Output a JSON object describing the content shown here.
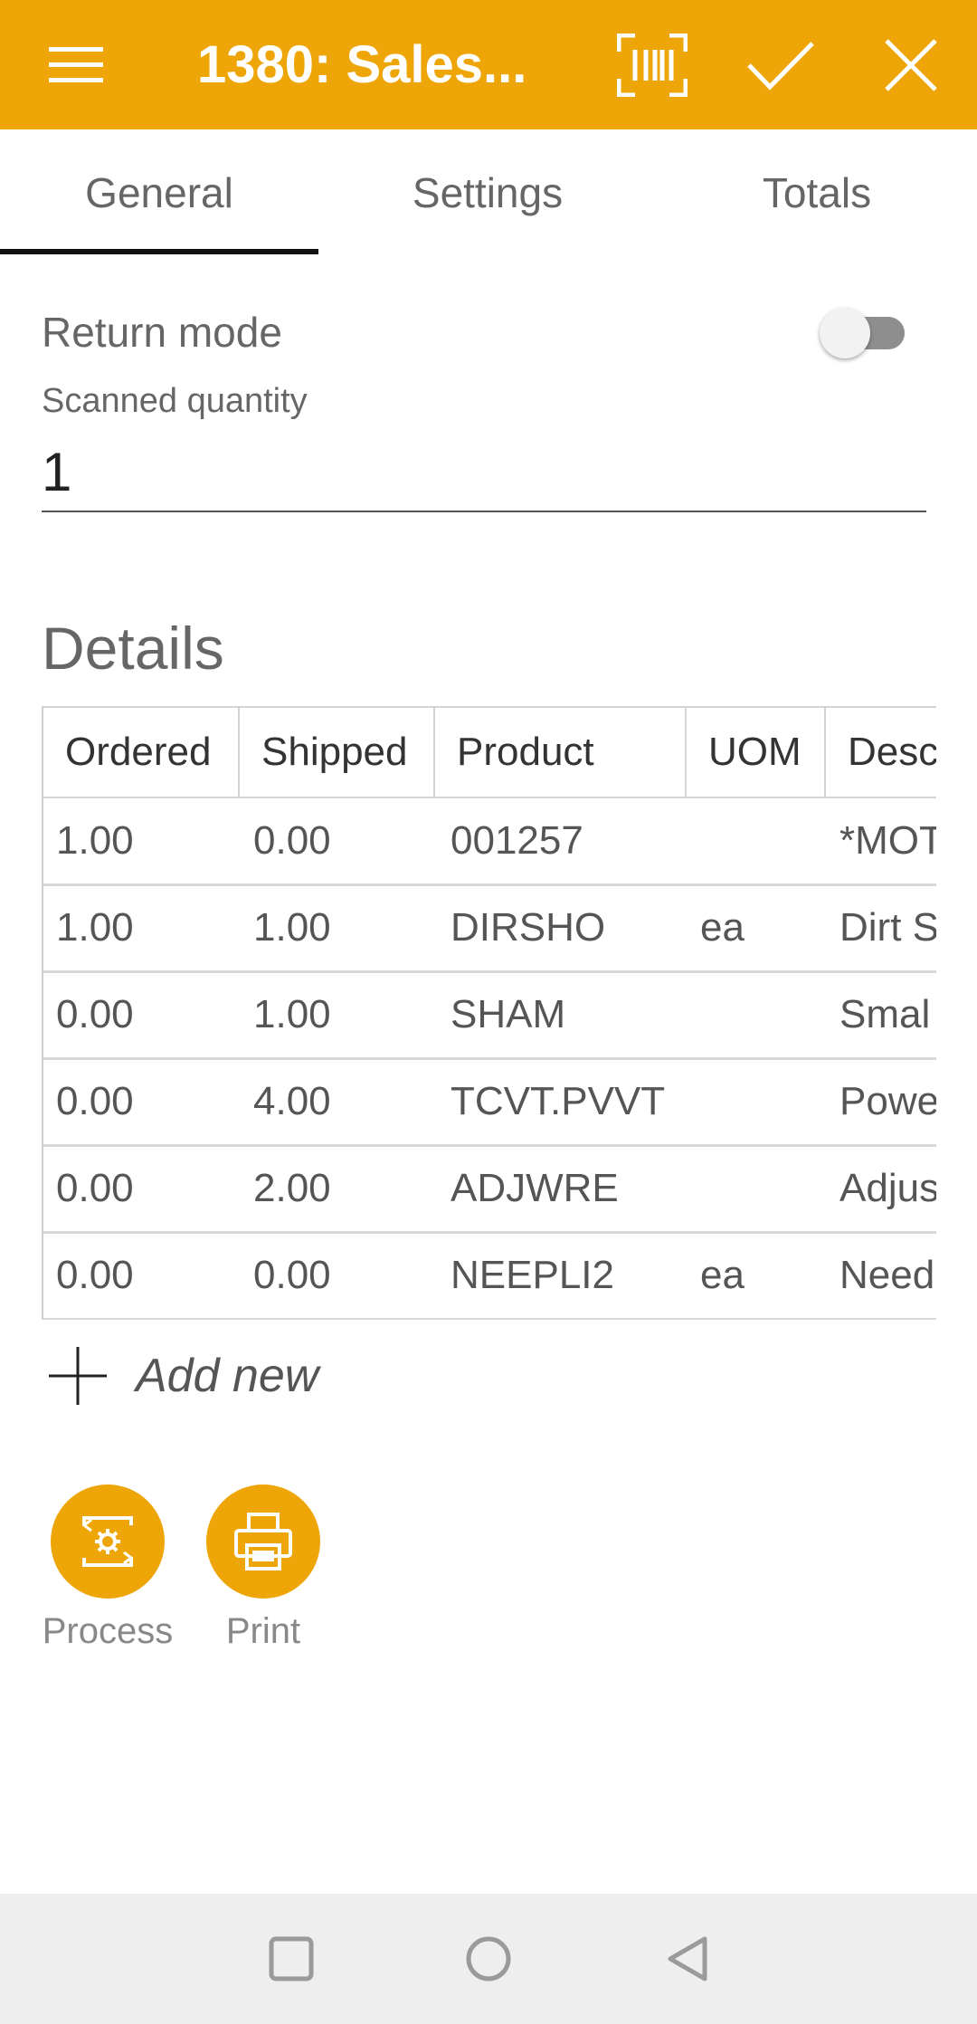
{
  "header": {
    "title": "1380: Sales...",
    "menu_icon": "hamburger-menu-icon",
    "scan_icon": "barcode-scan-icon",
    "confirm_icon": "check-icon",
    "close_icon": "close-icon",
    "background": "#eea507"
  },
  "tabs": [
    {
      "label": "General",
      "active": true
    },
    {
      "label": "Settings",
      "active": false
    },
    {
      "label": "Totals",
      "active": false
    }
  ],
  "general": {
    "return_mode_label": "Return mode",
    "return_mode_on": false,
    "scanned_quantity_label": "Scanned quantity",
    "scanned_quantity_value": "1"
  },
  "details": {
    "heading": "Details",
    "columns": [
      "Ordered",
      "Shipped",
      "Product",
      "UOM",
      "Desc"
    ],
    "rows": [
      [
        "1.00",
        "0.00",
        "001257",
        "",
        "*MOT"
      ],
      [
        "1.00",
        "1.00",
        "DIRSHO",
        "ea",
        "Dirt S"
      ],
      [
        "0.00",
        "1.00",
        "SHAM",
        "",
        "Smal"
      ],
      [
        "0.00",
        "4.00",
        "TCVT.PVVT",
        "",
        "Powe"
      ],
      [
        "0.00",
        "2.00",
        "ADJWRE",
        "",
        "Adjus"
      ],
      [
        "0.00",
        "0.00",
        "NEEPLI2",
        "ea",
        "Need"
      ]
    ],
    "add_new_label": "Add new"
  },
  "actions": [
    {
      "label": "Process",
      "icon": "process-settings-icon"
    },
    {
      "label": "Print",
      "icon": "printer-icon"
    }
  ],
  "navbar": {
    "recent_icon": "recent-apps-icon",
    "home_icon": "home-circle-icon",
    "back_icon": "back-triangle-icon"
  }
}
